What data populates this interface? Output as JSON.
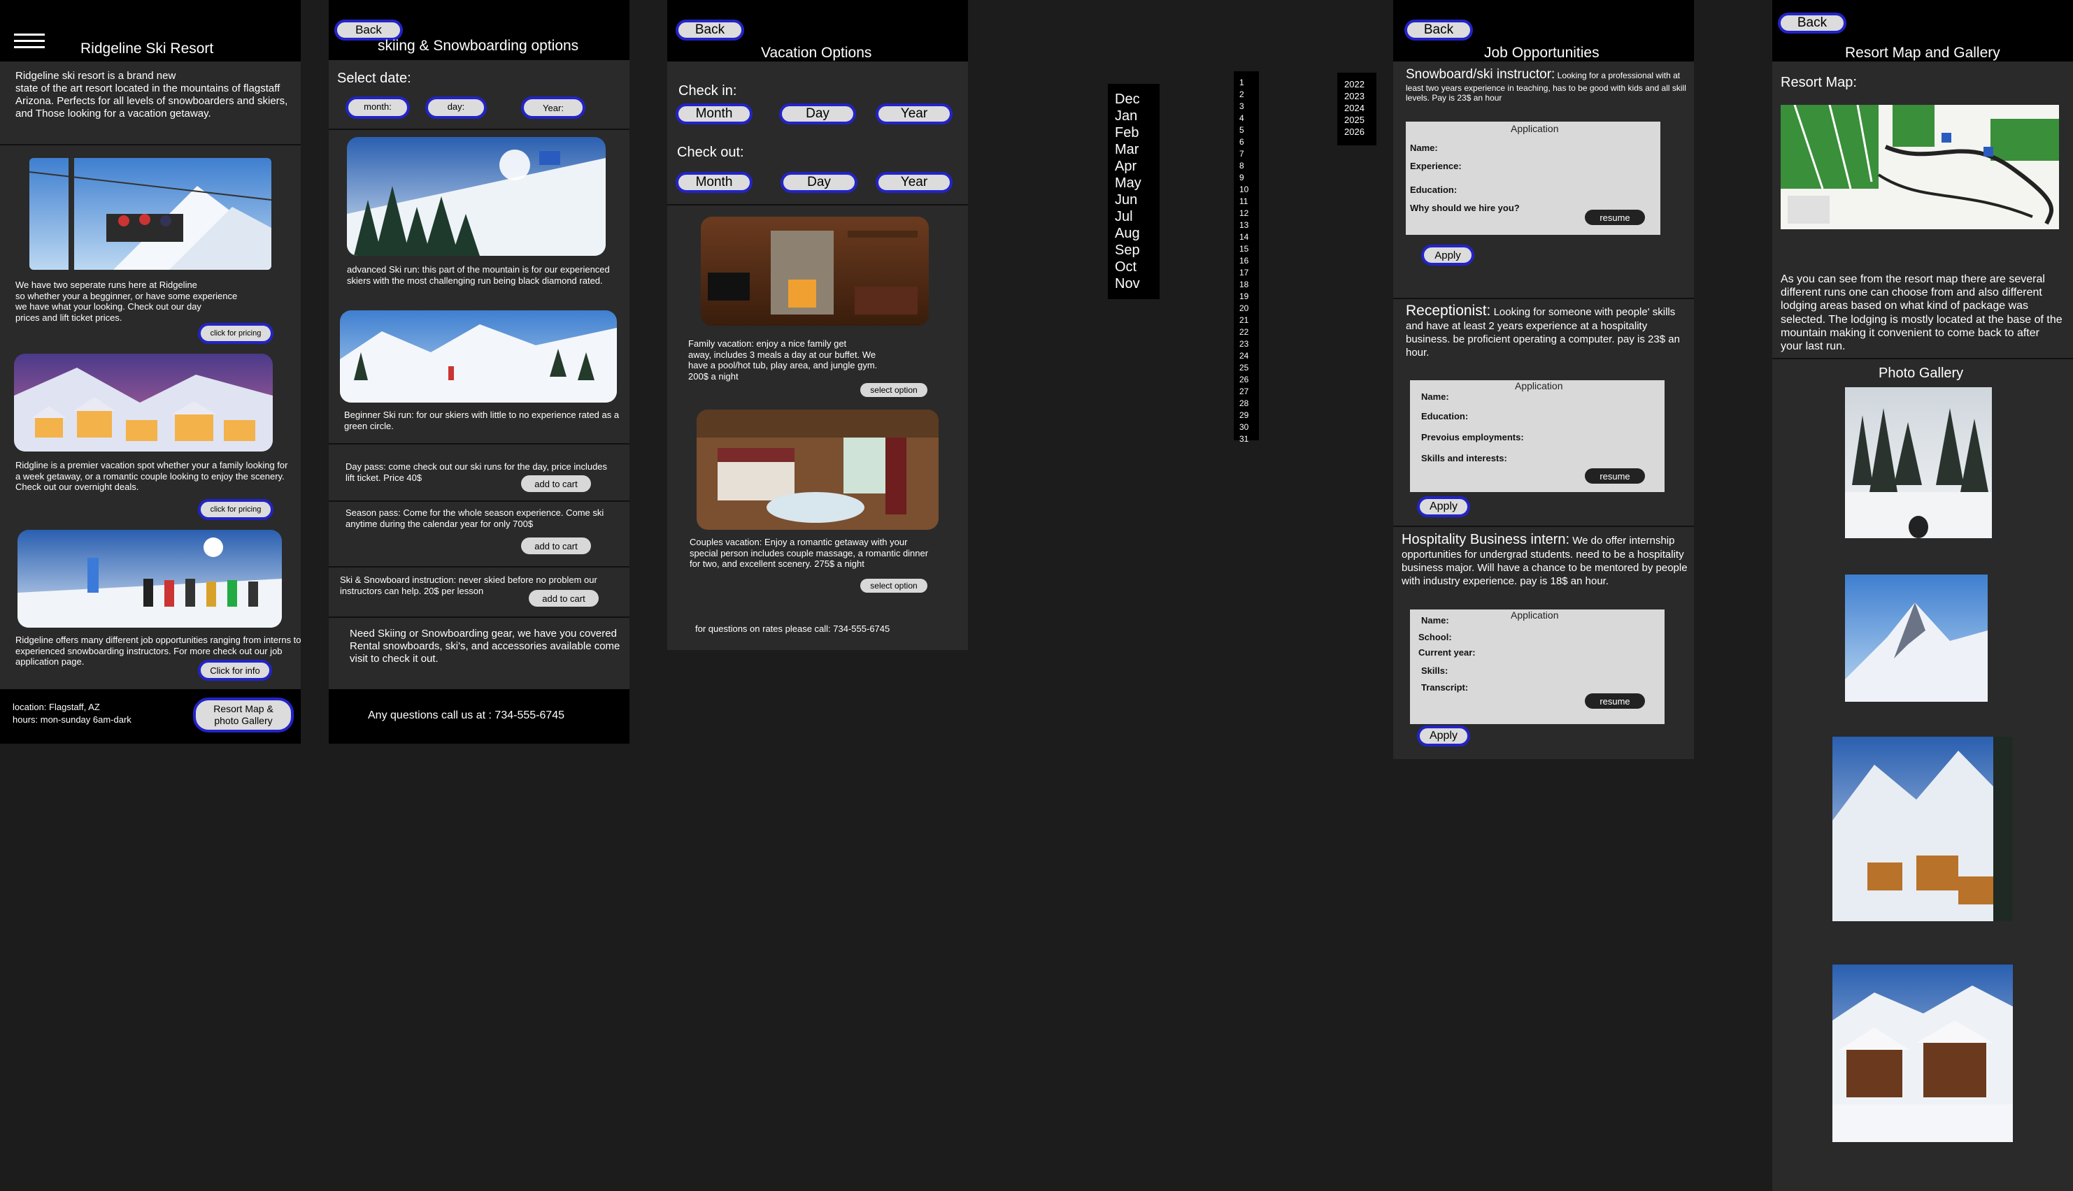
{
  "p1": {
    "title": "Ridgeline Ski Resort",
    "intro": "Ridgeline ski resort is a brand new\nstate of the art resort located in the  mountains of flagstaff Arizona. Perfects for all levels of snowboarders and skiers, and Those looking for a vacation getaway.",
    "runs_text": "We have two seperate runs here at Ridgeline\nso whether your a begginner, or have some experience\nwe have what your looking. Check out our day\nprices and lift ticket prices.",
    "pricing_btn_1": "click for pricing",
    "vacation_text": "Ridgline is a premier vacation spot whether your a family looking for a week getaway, or a romantic couple looking to enjoy the scenery. Check out our overnight deals.",
    "pricing_btn_2": "click for pricing",
    "jobs_text": "Ridgeline offers many different job opportunities ranging from interns to experienced snowboarding instructors. For more check out our job application page.",
    "info_btn": "Click for info",
    "location": "location: Flagstaff, AZ",
    "hours": "hours: mon-sunday 6am-dark",
    "map_btn": "Resort Map &\nphoto Gallery"
  },
  "p2": {
    "back": "Back",
    "title": "skiing & Snowboarding options",
    "select_date": "Select date:",
    "month": "month:",
    "day": "day:",
    "year": "Year:",
    "advanced": "advanced Ski run: this part of the mountain is for our experienced skiers with the most challenging run being black diamond rated.",
    "beginner": "Beginner Ski run: for our skiers with little to no experience rated as a green circle.",
    "day_pass": "Day pass: come check out our ski runs for the day, price includes lift ticket. Price 40$",
    "season_pass": "Season pass: Come for the whole season experience. Come ski anytime during the calendar year for only 700$",
    "instruction": "Ski & Snowboard instruction: never skied before no problem our instructors can help. 20$ per lesson",
    "add_to_cart": "add to cart",
    "gear": "Need Skiing or Snowboarding gear, we have you covered Rental snowboards, ski's, and accessories available come visit to check it out.",
    "questions": "Any questions call us at : 734-555-6745"
  },
  "p3": {
    "back": "Back",
    "title": "Vacation Options",
    "check_in": "Check in:",
    "check_out": "Check out:",
    "month": "Month",
    "day": "Day",
    "year": "Year",
    "family": "Family vacation: enjoy a nice family get\naway, includes 3 meals a day at our  buffet. We\nhave a pool/hot tub, play area, and jungle gym.\n200$ a night",
    "select_option": "select option",
    "couples": "Couples vacation: Enjoy a romantic getaway with your\nspecial person includes couple massage, a romantic dinner\n for two, and excellent scenery. 275$ a night",
    "rates_call": "for questions on rates please call: 734-555-6745"
  },
  "dropdowns": {
    "months": [
      "Dec",
      "Jan",
      "Feb",
      "Mar",
      "Apr",
      "May",
      "Jun",
      "Jul",
      "Aug",
      "Sep",
      "Oct",
      "Nov"
    ],
    "days": [
      "1",
      "2",
      "3",
      "4",
      "5",
      "6",
      "7",
      "8",
      "9",
      "10",
      "11",
      "12",
      "13",
      "14",
      "15",
      "16",
      "17",
      "18",
      "19",
      "20",
      "21",
      "22",
      "23",
      "24",
      "25",
      "26",
      "27",
      "28",
      "29",
      "30",
      "31"
    ],
    "years": [
      "2022",
      "2023",
      "2024",
      "2025",
      "2026"
    ]
  },
  "p4": {
    "back": "Back",
    "title": "Job Opportunities",
    "job1_title": "Snowboard/ski instructor:",
    "job1_desc": " Looking for a professional with at least two years experience in teaching, has to be good with kids and all skill levels. Pay is 23$ an hour",
    "form_title": "Application",
    "name": "Name:",
    "experience": "Experience:",
    "education": "Education:",
    "why": "Why should we hire you?",
    "resume": "resume",
    "apply": "Apply",
    "job2_title": "Receptionist:",
    "job2_desc": " Looking for someone with people' skills and have at least 2 years experience at a hospitality business. be proficient operating a computer. pay is 23$ an hour.",
    "prev_emp": "Prevoius employments:",
    "skills_interests": "Skills and interests:",
    "job3_title": "Hospitality Business intern:",
    "job3_desc": " We do offer internship opportunities for undergrad students. need to be a hospitality business major. Will  have a chance to be mentored by people with industry experience. pay is 18$ an hour.",
    "school": "School:",
    "current_year": "Current year:",
    "skills": "Skills:",
    "transcript": "Transcript:"
  },
  "p5": {
    "back": "Back",
    "title": "Resort Map and Gallery",
    "map_label": "Resort Map:",
    "map_desc": "As you can see from the resort map there are several different runs one can choose from and also different lodging areas based on what kind of package was selected. The lodging is mostly located at the base of the mountain making it convenient to come back to after your last run.",
    "gallery": "Photo Gallery"
  }
}
